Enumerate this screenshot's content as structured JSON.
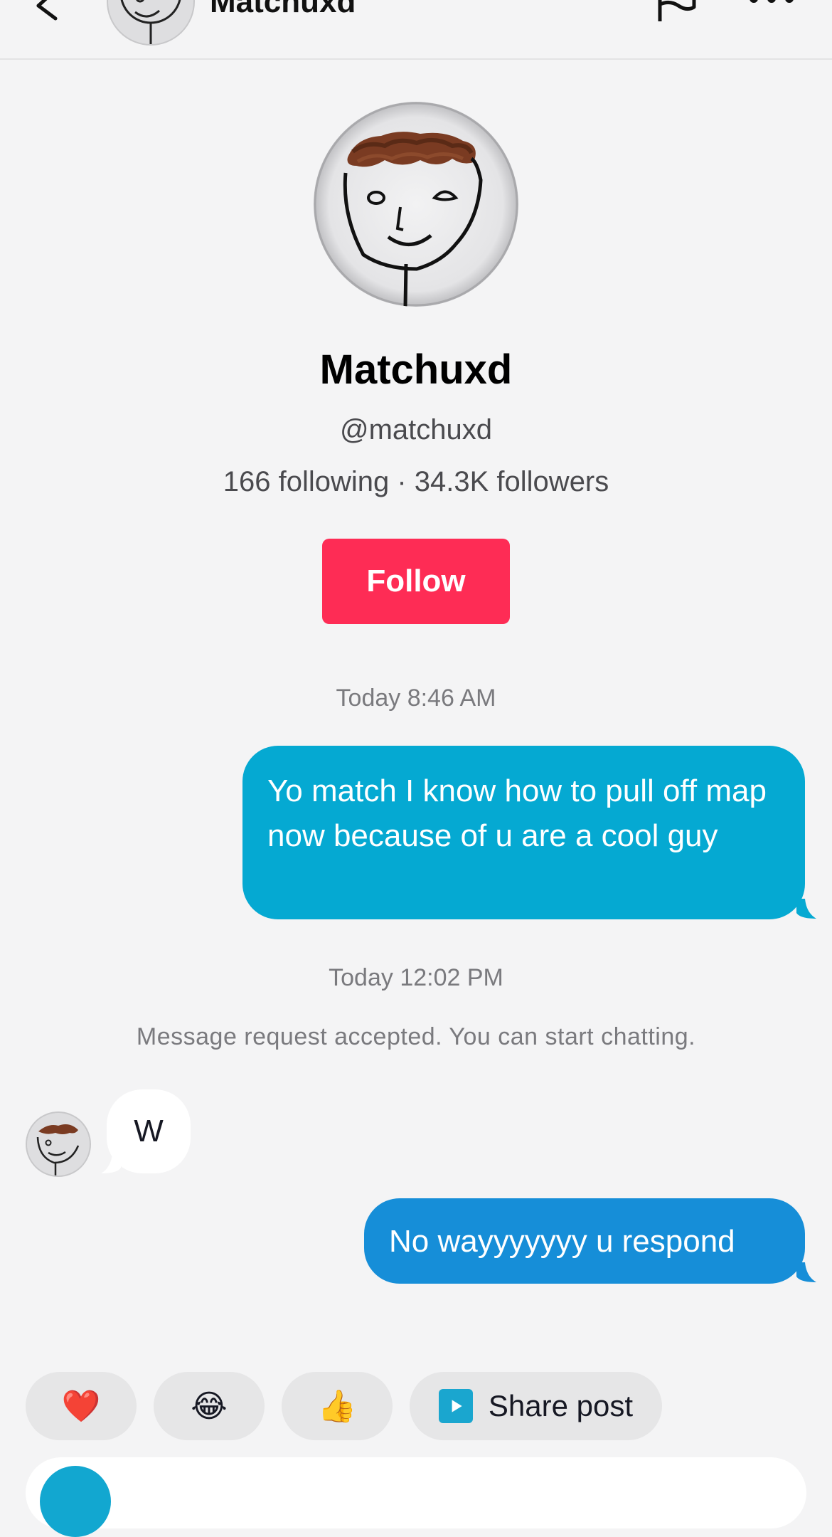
{
  "header": {
    "title": "Matchuxd",
    "icons": {
      "back": "back-arrow-icon",
      "report": "flag-icon",
      "more": "more-icon"
    }
  },
  "profile": {
    "name": "Matchuxd",
    "handle": "@matchuxd",
    "stats": "166 following · 34.3K followers",
    "follow_label": "Follow"
  },
  "chat": {
    "timestamp_1": "Today 8:46 AM",
    "message_1": "Yo match I know how to pull off map now because of u are a cool guy",
    "timestamp_2": "Today 12:02 PM",
    "system_message": "Message request accepted. You can start chatting.",
    "incoming_message": "W",
    "message_2": "No wayyyyyyy u respond"
  },
  "quick_replies": {
    "heart": "❤️",
    "laugh": "😂",
    "thumbs_up": "👍",
    "share_post": "Share post"
  },
  "colors": {
    "follow": "#fe2c55",
    "bubble_primary": "#05a9d2",
    "bubble_secondary": "#168ed8",
    "background": "#f4f4f5"
  }
}
